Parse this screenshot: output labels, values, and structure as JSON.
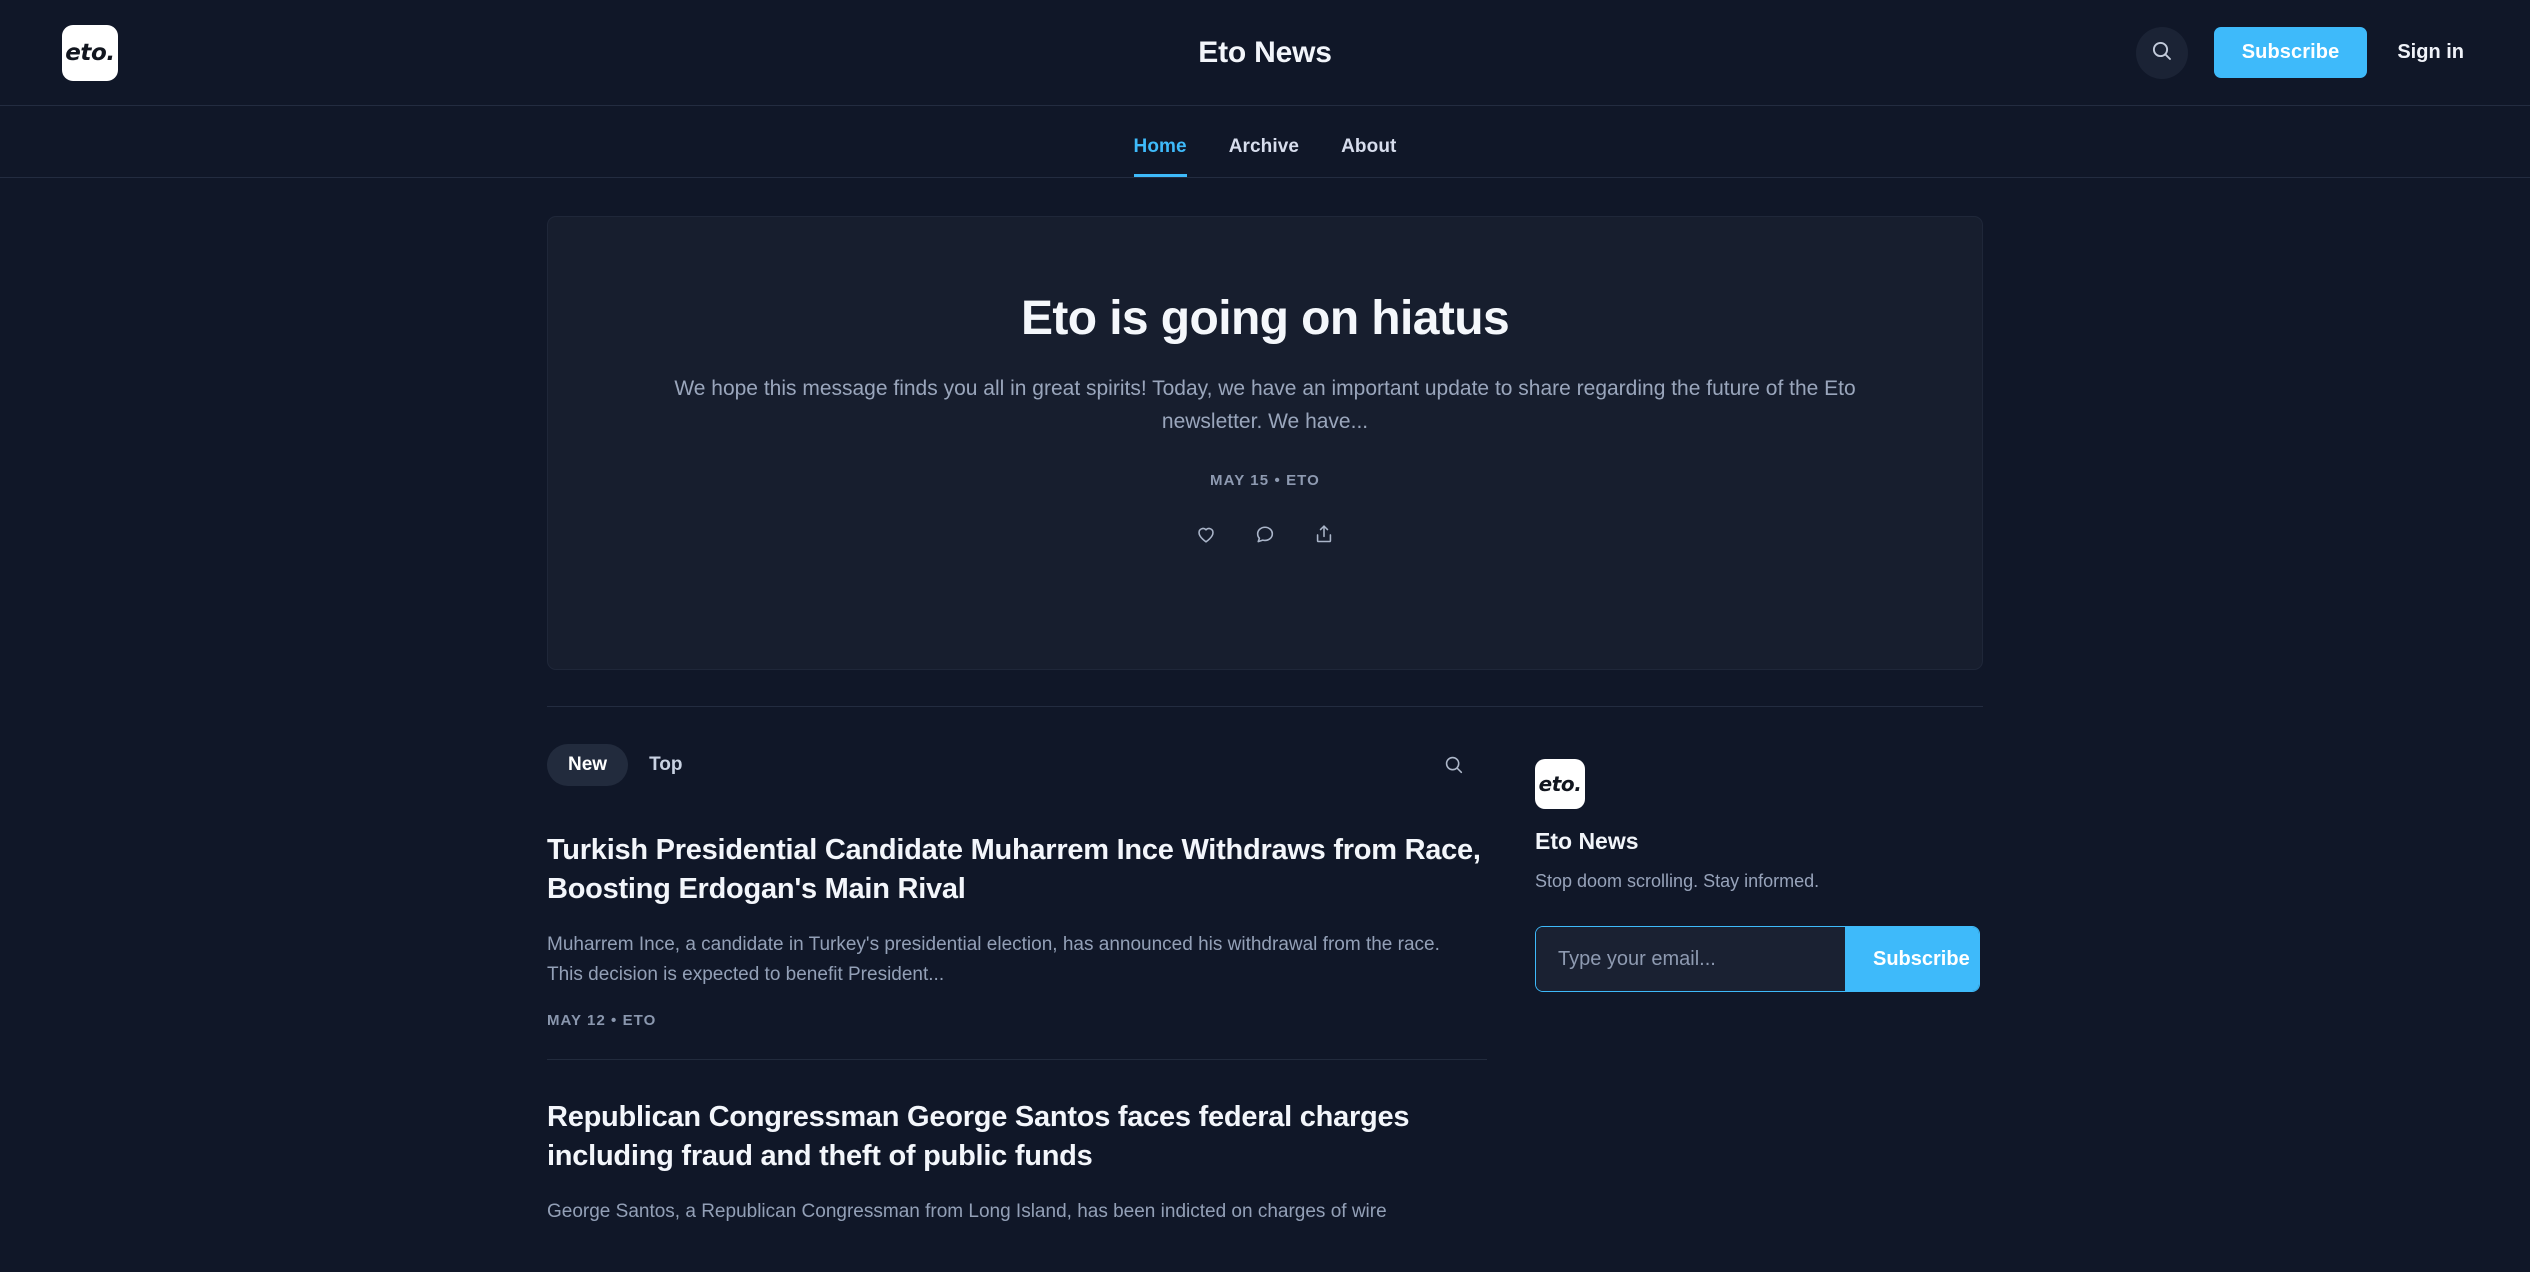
{
  "brand": {
    "logo_text": "eto.",
    "site_title": "Eto News"
  },
  "header": {
    "search_icon": "search-icon",
    "subscribe_label": "Subscribe",
    "signin_label": "Sign in"
  },
  "nav": {
    "items": [
      {
        "label": "Home",
        "active": true
      },
      {
        "label": "Archive",
        "active": false
      },
      {
        "label": "About",
        "active": false
      }
    ]
  },
  "hero": {
    "title": "Eto is going on hiatus",
    "description": "We hope this message finds you all in great spirits! Today, we have an important update to share regarding the future of the Eto newsletter. We have...",
    "date": "MAY 15",
    "author": "ETO",
    "meta": "MAY 15 • ETO",
    "actions": [
      {
        "icon": "heart-icon",
        "label": "Like"
      },
      {
        "icon": "comment-icon",
        "label": "Comment"
      },
      {
        "icon": "share-icon",
        "label": "Share"
      }
    ]
  },
  "feed": {
    "tabs": [
      {
        "label": "New",
        "active": true
      },
      {
        "label": "Top",
        "active": false
      }
    ],
    "search_icon": "search-icon",
    "posts": [
      {
        "title": "Turkish Presidential Candidate Muharrem Ince Withdraws from Race, Boosting Erdogan's Main Rival",
        "description": "Muharrem Ince, a candidate in Turkey's presidential election, has announced his withdrawal from the race. This decision is expected to benefit President...",
        "meta": "MAY 12 • ETO"
      },
      {
        "title": "Republican Congressman George Santos faces federal charges including fraud and theft of public funds",
        "description": "George Santos, a Republican Congressman from Long Island, has been indicted on charges of wire",
        "meta": ""
      }
    ]
  },
  "sidebar": {
    "logo_text": "eto.",
    "name": "Eto News",
    "tagline": "Stop doom scrolling. Stay informed.",
    "email_placeholder": "Type your email...",
    "email_value": "",
    "subscribe_label": "Subscribe"
  },
  "colors": {
    "page_bg": "#101728",
    "card_bg": "#171e2e",
    "accent": "#3ebafa",
    "text_primary": "#f2f5fa",
    "text_muted": "#97a3ba",
    "border": "#232c40"
  }
}
